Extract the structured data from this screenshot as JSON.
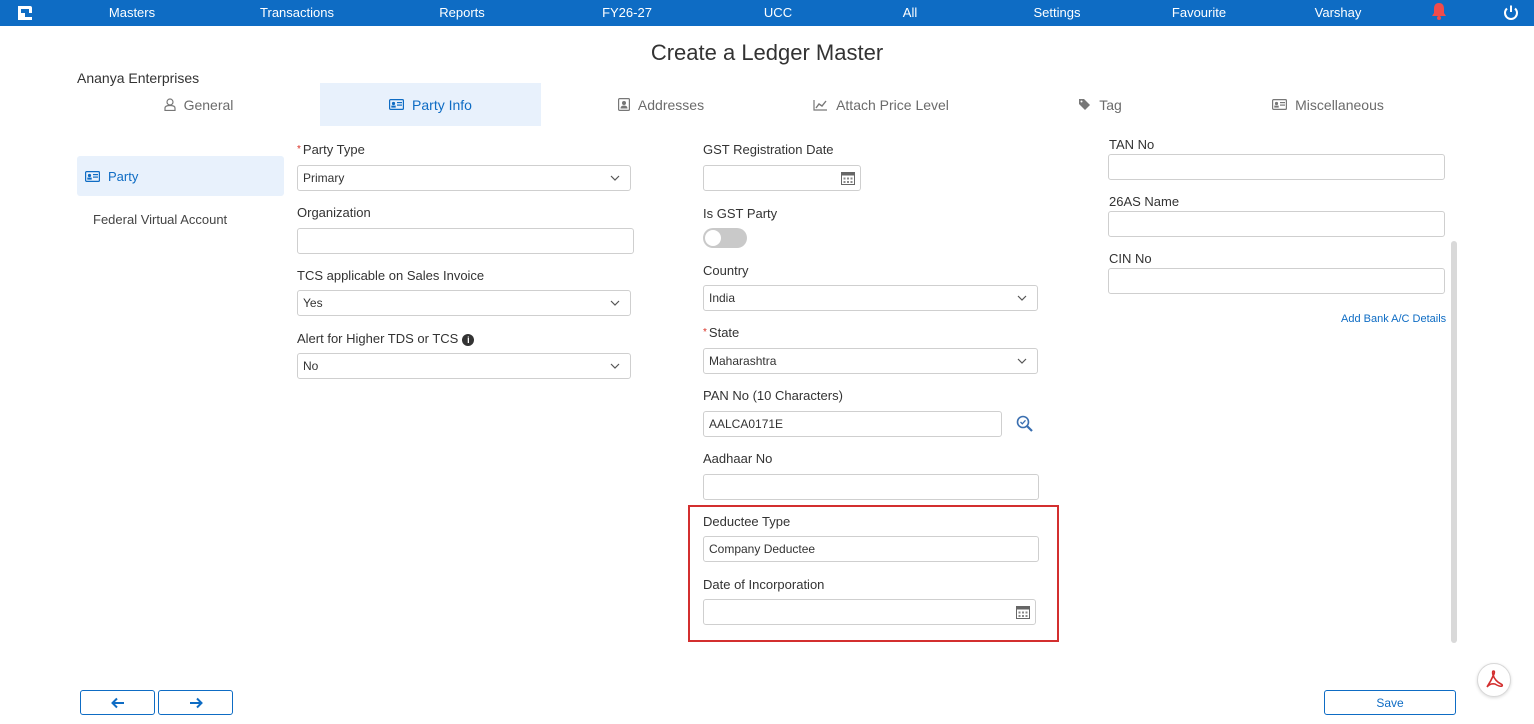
{
  "nav": {
    "items": [
      "Masters",
      "Transactions",
      "Reports",
      "FY26-27",
      "UCC",
      "All",
      "Settings",
      "Favourite",
      "Varshay"
    ]
  },
  "page": {
    "title": "Create a Ledger Master",
    "company": "Ananya Enterprises"
  },
  "tabs": [
    {
      "label": "General",
      "icon": "person-outline-icon"
    },
    {
      "label": "Party Info",
      "icon": "id-card-icon",
      "active": true
    },
    {
      "label": "Addresses",
      "icon": "contact-book-icon"
    },
    {
      "label": "Attach Price Level",
      "icon": "line-chart-icon"
    },
    {
      "label": "Tag",
      "icon": "tag-icon"
    },
    {
      "label": "Miscellaneous",
      "icon": "id-card-icon"
    }
  ],
  "sidebar": {
    "items": [
      {
        "label": "Party",
        "active": true
      },
      {
        "label": "Federal Virtual Account"
      }
    ]
  },
  "form": {
    "party_type": {
      "label": "Party Type",
      "value": "Primary",
      "required": true
    },
    "organization": {
      "label": "Organization",
      "value": ""
    },
    "tcs_applicable": {
      "label": "TCS applicable on Sales Invoice",
      "value": "Yes"
    },
    "alert_higher_tds": {
      "label": "Alert for Higher TDS or TCS",
      "value": "No"
    },
    "gst_reg_date": {
      "label": "GST Registration Date",
      "value": ""
    },
    "is_gst_party": {
      "label": "Is GST Party",
      "on": false
    },
    "country": {
      "label": "Country",
      "value": "India"
    },
    "state": {
      "label": "State",
      "value": "Maharashtra",
      "required": true
    },
    "pan_no": {
      "label": "PAN No (10 Characters)",
      "value": "AALCA0171E"
    },
    "aadhaar_no": {
      "label": "Aadhaar No",
      "value": ""
    },
    "deductee_type": {
      "label": "Deductee Type",
      "value": "Company Deductee"
    },
    "date_of_incorporation": {
      "label": "Date of Incorporation",
      "value": ""
    },
    "tan_no": {
      "label": "TAN No",
      "value": ""
    },
    "name_26as": {
      "label": "26AS Name",
      "value": ""
    },
    "cin_no": {
      "label": "CIN No",
      "value": ""
    },
    "add_bank_link": "Add Bank A/C Details"
  },
  "footer": {
    "save_label": "Save"
  },
  "colors": {
    "brand": "#0e6cc4",
    "highlight": "#d32f2f",
    "bell": "#f04b4b"
  }
}
